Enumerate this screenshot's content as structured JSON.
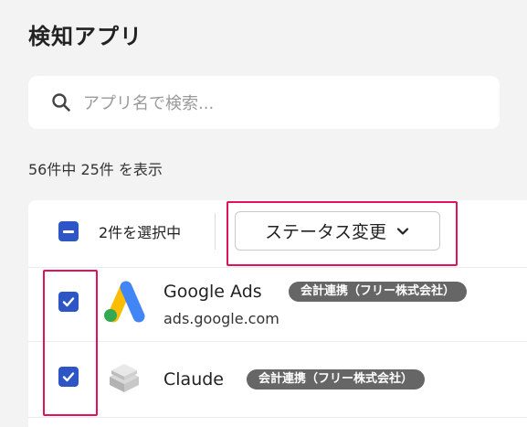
{
  "page": {
    "title": "検知アプリ"
  },
  "search": {
    "placeholder": "アプリ名で検索..."
  },
  "results": {
    "count_text": "56件中 25件 を表示"
  },
  "toolbar": {
    "selected_text": "2件を選択中",
    "status_button_label": "ステータス変更"
  },
  "apps": [
    {
      "name": "Google Ads",
      "domain": "ads.google.com",
      "badge": "会計連携（フリー株式会社）",
      "checked": true
    },
    {
      "name": "Claude",
      "domain": "",
      "badge": "会計連携（フリー株式会社）",
      "checked": true
    }
  ],
  "colors": {
    "accent": "#2d55c6",
    "highlight": "#e0115f",
    "badge_bg": "#666666",
    "page_bg": "#f3f3f3"
  }
}
